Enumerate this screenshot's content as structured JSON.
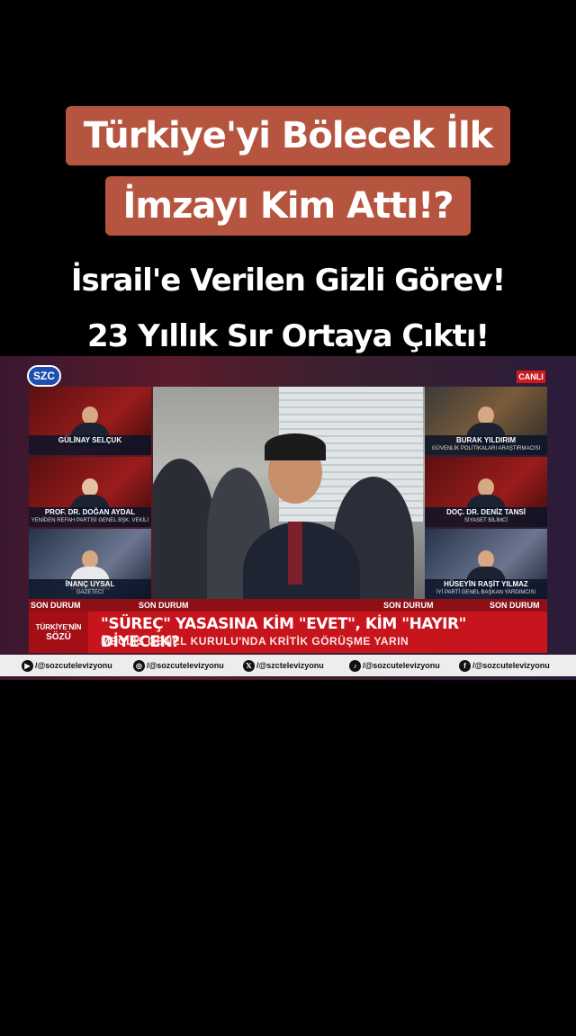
{
  "headline_box": {
    "line1": "Türkiye'yi Bölecek İlk",
    "line2": "İmzayı Kim Attı!?"
  },
  "subtitle": {
    "line1": "İsrail'e Verilen Gizli Görev!",
    "line2": "23 Yıllık Sır Ortaya Çıktı!"
  },
  "broadcast": {
    "logo": "SZC",
    "live_badge": "CANLI",
    "guests_left": [
      {
        "name": "GÜLİNAY SELÇUK",
        "role": ""
      },
      {
        "name": "PROF. DR. DOĞAN AYDAL",
        "role": "YENİDEN REFAH PARTİSİ GENEL BŞK. VEKİLİ"
      },
      {
        "name": "İNANÇ UYSAL",
        "role": "GAZETECİ"
      }
    ],
    "guests_right": [
      {
        "name": "BURAK YILDIRIM",
        "role": "GÜVENLİK POLİTİKALARI ARAŞTIRMACISI"
      },
      {
        "name": "DOÇ. DR. DENİZ TANSİ",
        "role": "SİYASET BİLİMCİ"
      },
      {
        "name": "HÜSEYİN RAŞİT YILMAZ",
        "role": "İYİ PARTİ GENEL BAŞKAN YARDIMCISI"
      }
    ],
    "ticker_label": "SON DURUM",
    "program_tag_line1": "TÜRKİYE'NİN",
    "program_tag_line2": "SÖZÜ",
    "headline": "\"SÜREÇ\" YASASINA KİM \"EVET\", KİM \"HAYIR\" DİYECEK?",
    "subheadline": "MECLİS GENEL KURULU'NDA KRİTİK GÖRÜŞME YARIN",
    "socials": [
      {
        "icon": "youtube-icon",
        "glyph": "▶",
        "handle": "/@sozcutelevizyonu"
      },
      {
        "icon": "instagram-icon",
        "glyph": "◎",
        "handle": "/@sozcutelevizyonu"
      },
      {
        "icon": "x-twitter-icon",
        "glyph": "𝕏",
        "handle": "/@szctelevizyonu"
      },
      {
        "icon": "tiktok-icon",
        "glyph": "♪",
        "handle": "/@sozcutelevizyonu"
      },
      {
        "icon": "facebook-icon",
        "glyph": "f",
        "handle": "/@sozcutelevizyonu"
      }
    ]
  },
  "colors": {
    "title_box_bg": "#b6553f",
    "lower_third_red": "#c8141d",
    "live_red": "#d0191f"
  }
}
